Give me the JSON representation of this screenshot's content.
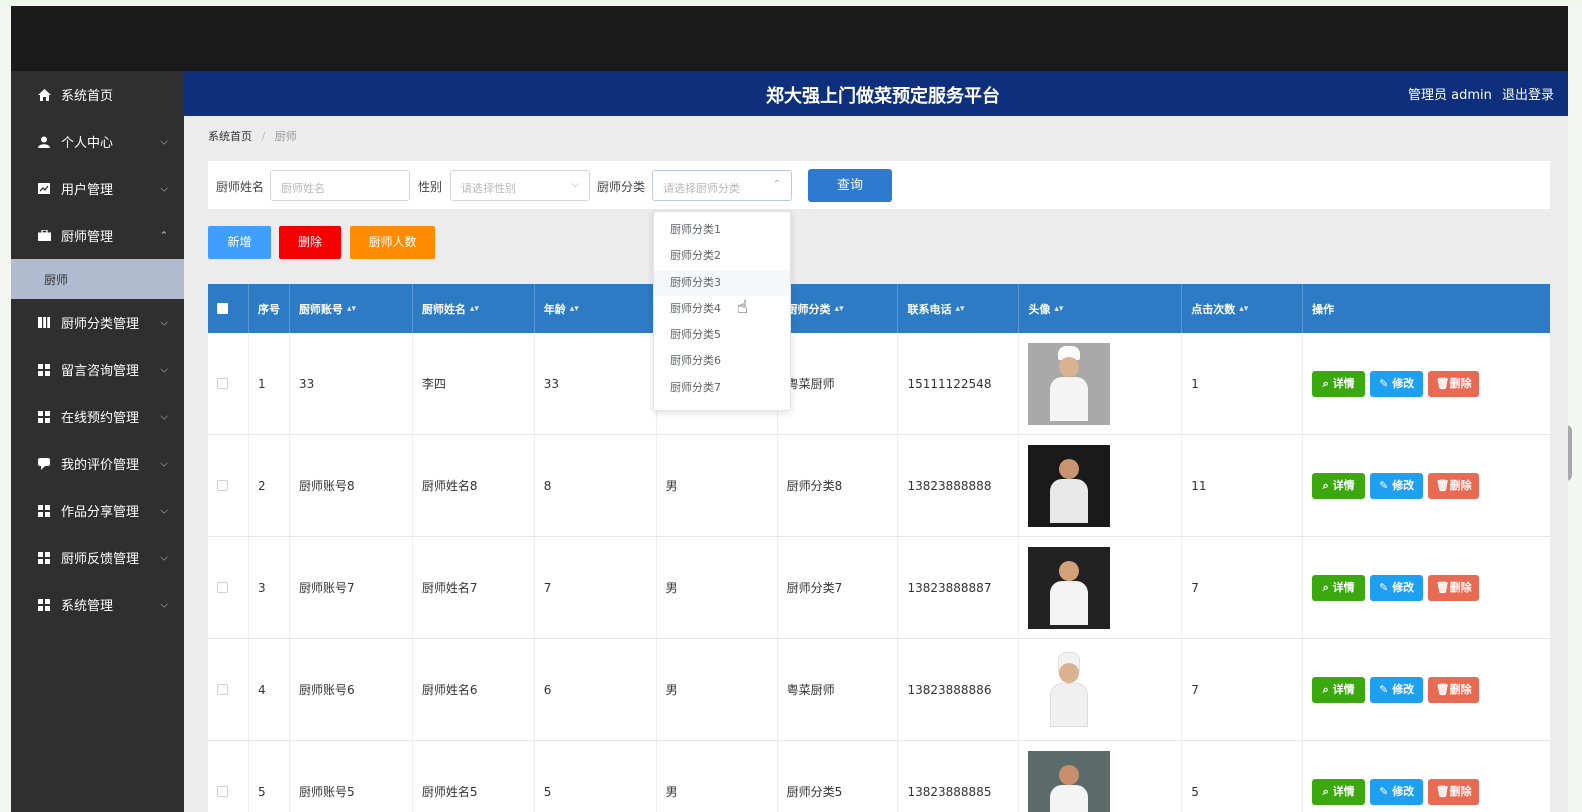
{
  "header": {
    "title": "郑大强上门做菜预定服务平台",
    "user_role": "管理员 admin",
    "logout": "退出登录"
  },
  "sidebar": {
    "items": [
      {
        "label": "系统首页",
        "icon": "home-icon"
      },
      {
        "label": "个人中心",
        "icon": "user-icon"
      },
      {
        "label": "用户管理",
        "icon": "chart-icon"
      },
      {
        "label": "厨师管理",
        "icon": "briefcase-icon",
        "expanded": true
      },
      {
        "label": "厨师分类管理",
        "icon": "columns-icon"
      },
      {
        "label": "留言咨询管理",
        "icon": "grid-icon"
      },
      {
        "label": "在线预约管理",
        "icon": "grid-icon"
      },
      {
        "label": "我的评价管理",
        "icon": "comment-icon"
      },
      {
        "label": "作品分享管理",
        "icon": "grid-icon"
      },
      {
        "label": "厨师反馈管理",
        "icon": "grid-icon"
      },
      {
        "label": "系统管理",
        "icon": "grid-icon"
      }
    ],
    "submenu": {
      "label": "厨师"
    }
  },
  "breadcrumb": {
    "home": "系统首页",
    "sep": "/",
    "current": "厨师"
  },
  "search": {
    "name_label": "厨师姓名",
    "name_placeholder": "厨师姓名",
    "gender_label": "性别",
    "gender_placeholder": "请选择性别",
    "category_label": "厨师分类",
    "category_placeholder": "请选择厨师分类",
    "query_button": "查询"
  },
  "actions": {
    "add": "新增",
    "delete": "删除",
    "count": "厨师人数"
  },
  "table": {
    "headers": {
      "index": "序号",
      "account": "厨师账号",
      "name": "厨师姓名",
      "age": "年龄",
      "category": "厨师分类",
      "phone": "联系电话",
      "avatar": "头像",
      "clicks": "点击次数",
      "ops": "操作"
    },
    "op_labels": {
      "detail": "详情",
      "edit": "修改",
      "delete": "删除"
    },
    "rows": [
      {
        "index": "1",
        "account": "33",
        "name": "李四",
        "age": "33",
        "gender": "",
        "category": "粤菜厨师",
        "phone": "15111122548",
        "clicks": "1"
      },
      {
        "index": "2",
        "account": "厨师账号8",
        "name": "厨师姓名8",
        "age": "8",
        "gender": "男",
        "category": "厨师分类8",
        "phone": "13823888888",
        "clicks": "11"
      },
      {
        "index": "3",
        "account": "厨师账号7",
        "name": "厨师姓名7",
        "age": "7",
        "gender": "男",
        "category": "厨师分类7",
        "phone": "13823888887",
        "clicks": "7"
      },
      {
        "index": "4",
        "account": "厨师账号6",
        "name": "厨师姓名6",
        "age": "6",
        "gender": "男",
        "category": "粤菜厨师",
        "phone": "13823888886",
        "clicks": "7"
      },
      {
        "index": "5",
        "account": "厨师账号5",
        "name": "厨师姓名5",
        "age": "5",
        "gender": "男",
        "category": "厨师分类5",
        "phone": "13823888885",
        "clicks": "5"
      }
    ]
  },
  "dropdown": {
    "options": [
      "厨师分类1",
      "厨师分类2",
      "厨师分类3",
      "厨师分类4",
      "厨师分类5",
      "厨师分类6",
      "厨师分类7"
    ]
  },
  "colors": {
    "header_bg": "#0d2f7c",
    "sidebar_bg": "#2f2f2f",
    "table_head": "#2d7bc4",
    "add_btn": "#409eff",
    "delete_btn": "#f40000",
    "count_btn": "#ff8c00",
    "detail_btn": "#3ba80f",
    "edit_btn": "#1ea0f0",
    "remove_btn": "#e96a53"
  }
}
